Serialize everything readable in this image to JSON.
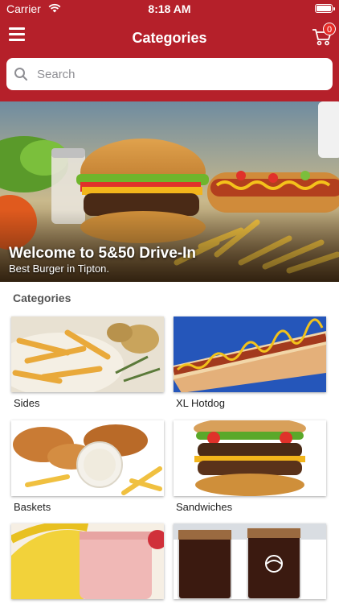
{
  "status_bar": {
    "carrier": "Carrier",
    "time": "8:18 AM"
  },
  "header": {
    "title": "Categories",
    "cart_count": "0"
  },
  "search": {
    "placeholder": "Search"
  },
  "hero": {
    "title": "Welcome to 5&50 Drive-In",
    "subtitle": "Best Burger in Tipton."
  },
  "categories_section": {
    "title": "Categories",
    "items": [
      {
        "label": "Sides"
      },
      {
        "label": "XL Hotdog"
      },
      {
        "label": "Baskets"
      },
      {
        "label": "Sandwiches"
      },
      {
        "label": ""
      },
      {
        "label": ""
      }
    ]
  },
  "colors": {
    "brand_red": "#b5202a",
    "badge_red": "#e52b26"
  }
}
